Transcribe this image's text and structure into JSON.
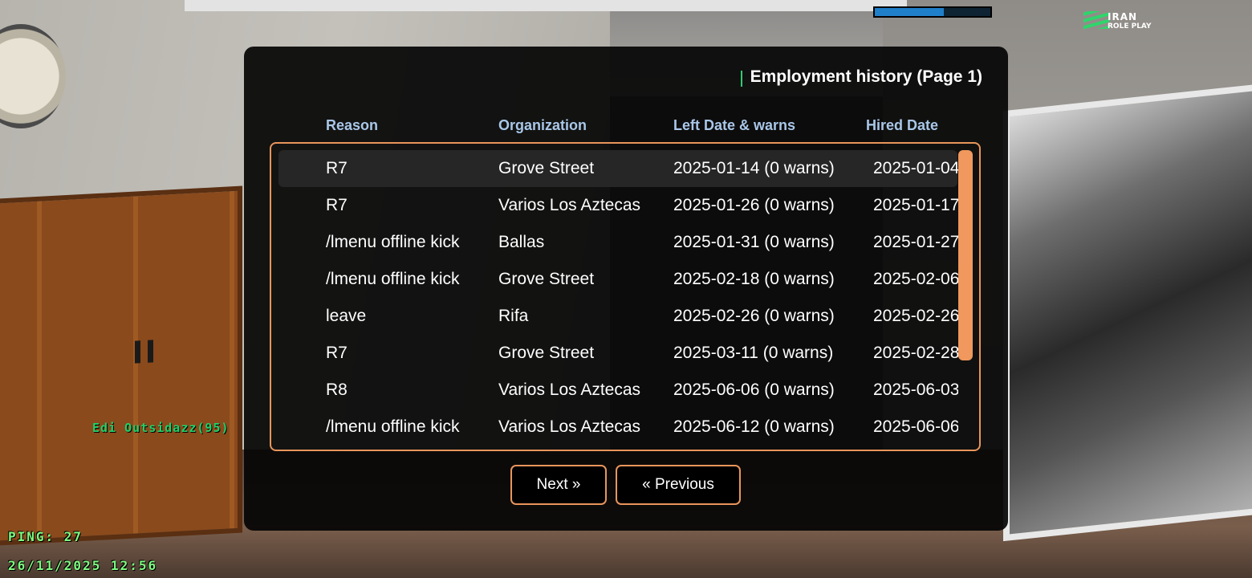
{
  "hud": {
    "logo_line1": "IRAN",
    "logo_line2": "ROLE PLAY",
    "player_name": "Edi Outsidazz(95)",
    "ping": "PING: 27",
    "datetime": "26/11/2025 12:56",
    "top_bar_fill": 0.6
  },
  "dialog": {
    "title": "Employment history (Page 1)",
    "columns": [
      "Reason",
      "Organization",
      "Left Date & warns",
      "Hired Date"
    ],
    "rows": [
      {
        "reason": "R7",
        "organization": "Grove Street",
        "left": "2025-01-14 (0 warns)",
        "hired": "2025-01-04"
      },
      {
        "reason": "R7",
        "organization": "Varios Los Aztecas",
        "left": "2025-01-26 (0 warns)",
        "hired": "2025-01-17"
      },
      {
        "reason": "/lmenu offline kick",
        "organization": "Ballas",
        "left": "2025-01-31 (0 warns)",
        "hired": "2025-01-27"
      },
      {
        "reason": "/lmenu offline kick",
        "organization": "Grove Street",
        "left": "2025-02-18 (0 warns)",
        "hired": "2025-02-06"
      },
      {
        "reason": "leave",
        "organization": "Rifa",
        "left": "2025-02-26 (0 warns)",
        "hired": "2025-02-26"
      },
      {
        "reason": "R7",
        "organization": "Grove Street",
        "left": "2025-03-11 (0 warns)",
        "hired": "2025-02-28"
      },
      {
        "reason": "R8",
        "organization": "Varios Los Aztecas",
        "left": "2025-06-06 (0 warns)",
        "hired": "2025-06-03"
      },
      {
        "reason": "/lmenu offline kick",
        "organization": "Varios Los Aztecas",
        "left": "2025-06-12 (0 warns)",
        "hired": "2025-06-06"
      }
    ],
    "selected_row": 0,
    "next_label": "Next »",
    "prev_label": "« Previous"
  },
  "colors": {
    "accent": "#e8955b",
    "title_bar": "#2ecc71",
    "header_text": "#a9c7e8",
    "hud_green": "#7dfc80"
  }
}
